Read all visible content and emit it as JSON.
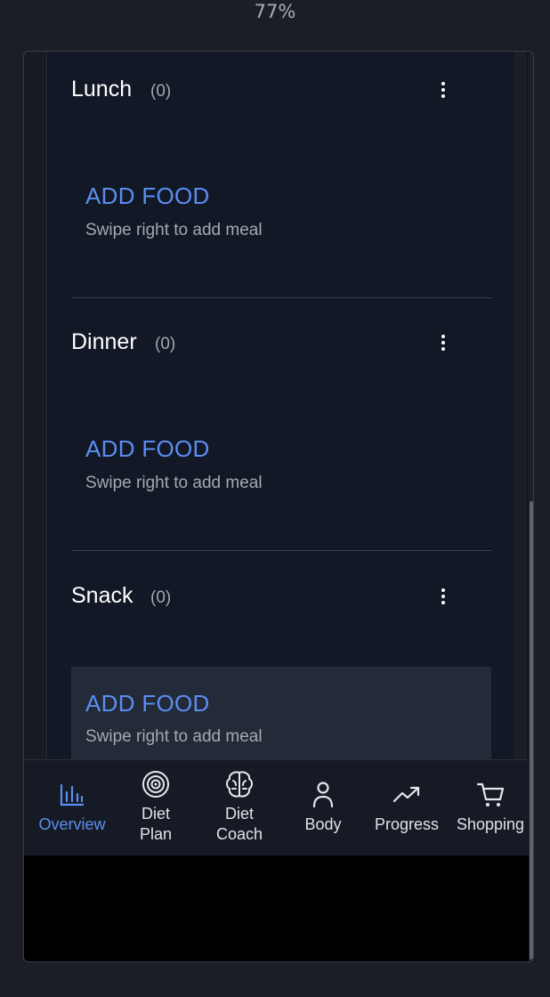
{
  "zoom_level": "77%",
  "meals": [
    {
      "title": "Lunch",
      "count": "(0)",
      "add_label": "ADD FOOD",
      "hint": "Swipe right to add meal"
    },
    {
      "title": "Dinner",
      "count": "(0)",
      "add_label": "ADD FOOD",
      "hint": "Swipe right to add meal"
    },
    {
      "title": "Snack",
      "count": "(0)",
      "add_label": "ADD FOOD",
      "hint": "Swipe right to add meal"
    }
  ],
  "nav": [
    {
      "label": "Overview",
      "icon": "bar-chart-icon",
      "active": true
    },
    {
      "label": "Diet\nPlan",
      "icon": "target-icon",
      "active": false
    },
    {
      "label": "Diet\nCoach",
      "icon": "brain-icon",
      "active": false
    },
    {
      "label": "Body",
      "icon": "person-icon",
      "active": false
    },
    {
      "label": "Progress",
      "icon": "trending-up-icon",
      "active": false
    },
    {
      "label": "Shopping",
      "icon": "cart-icon",
      "active": false
    }
  ],
  "colors": {
    "accent": "#5b8ef0",
    "background": "#121826",
    "text": "#ffffff",
    "muted": "#a4a9b3"
  }
}
